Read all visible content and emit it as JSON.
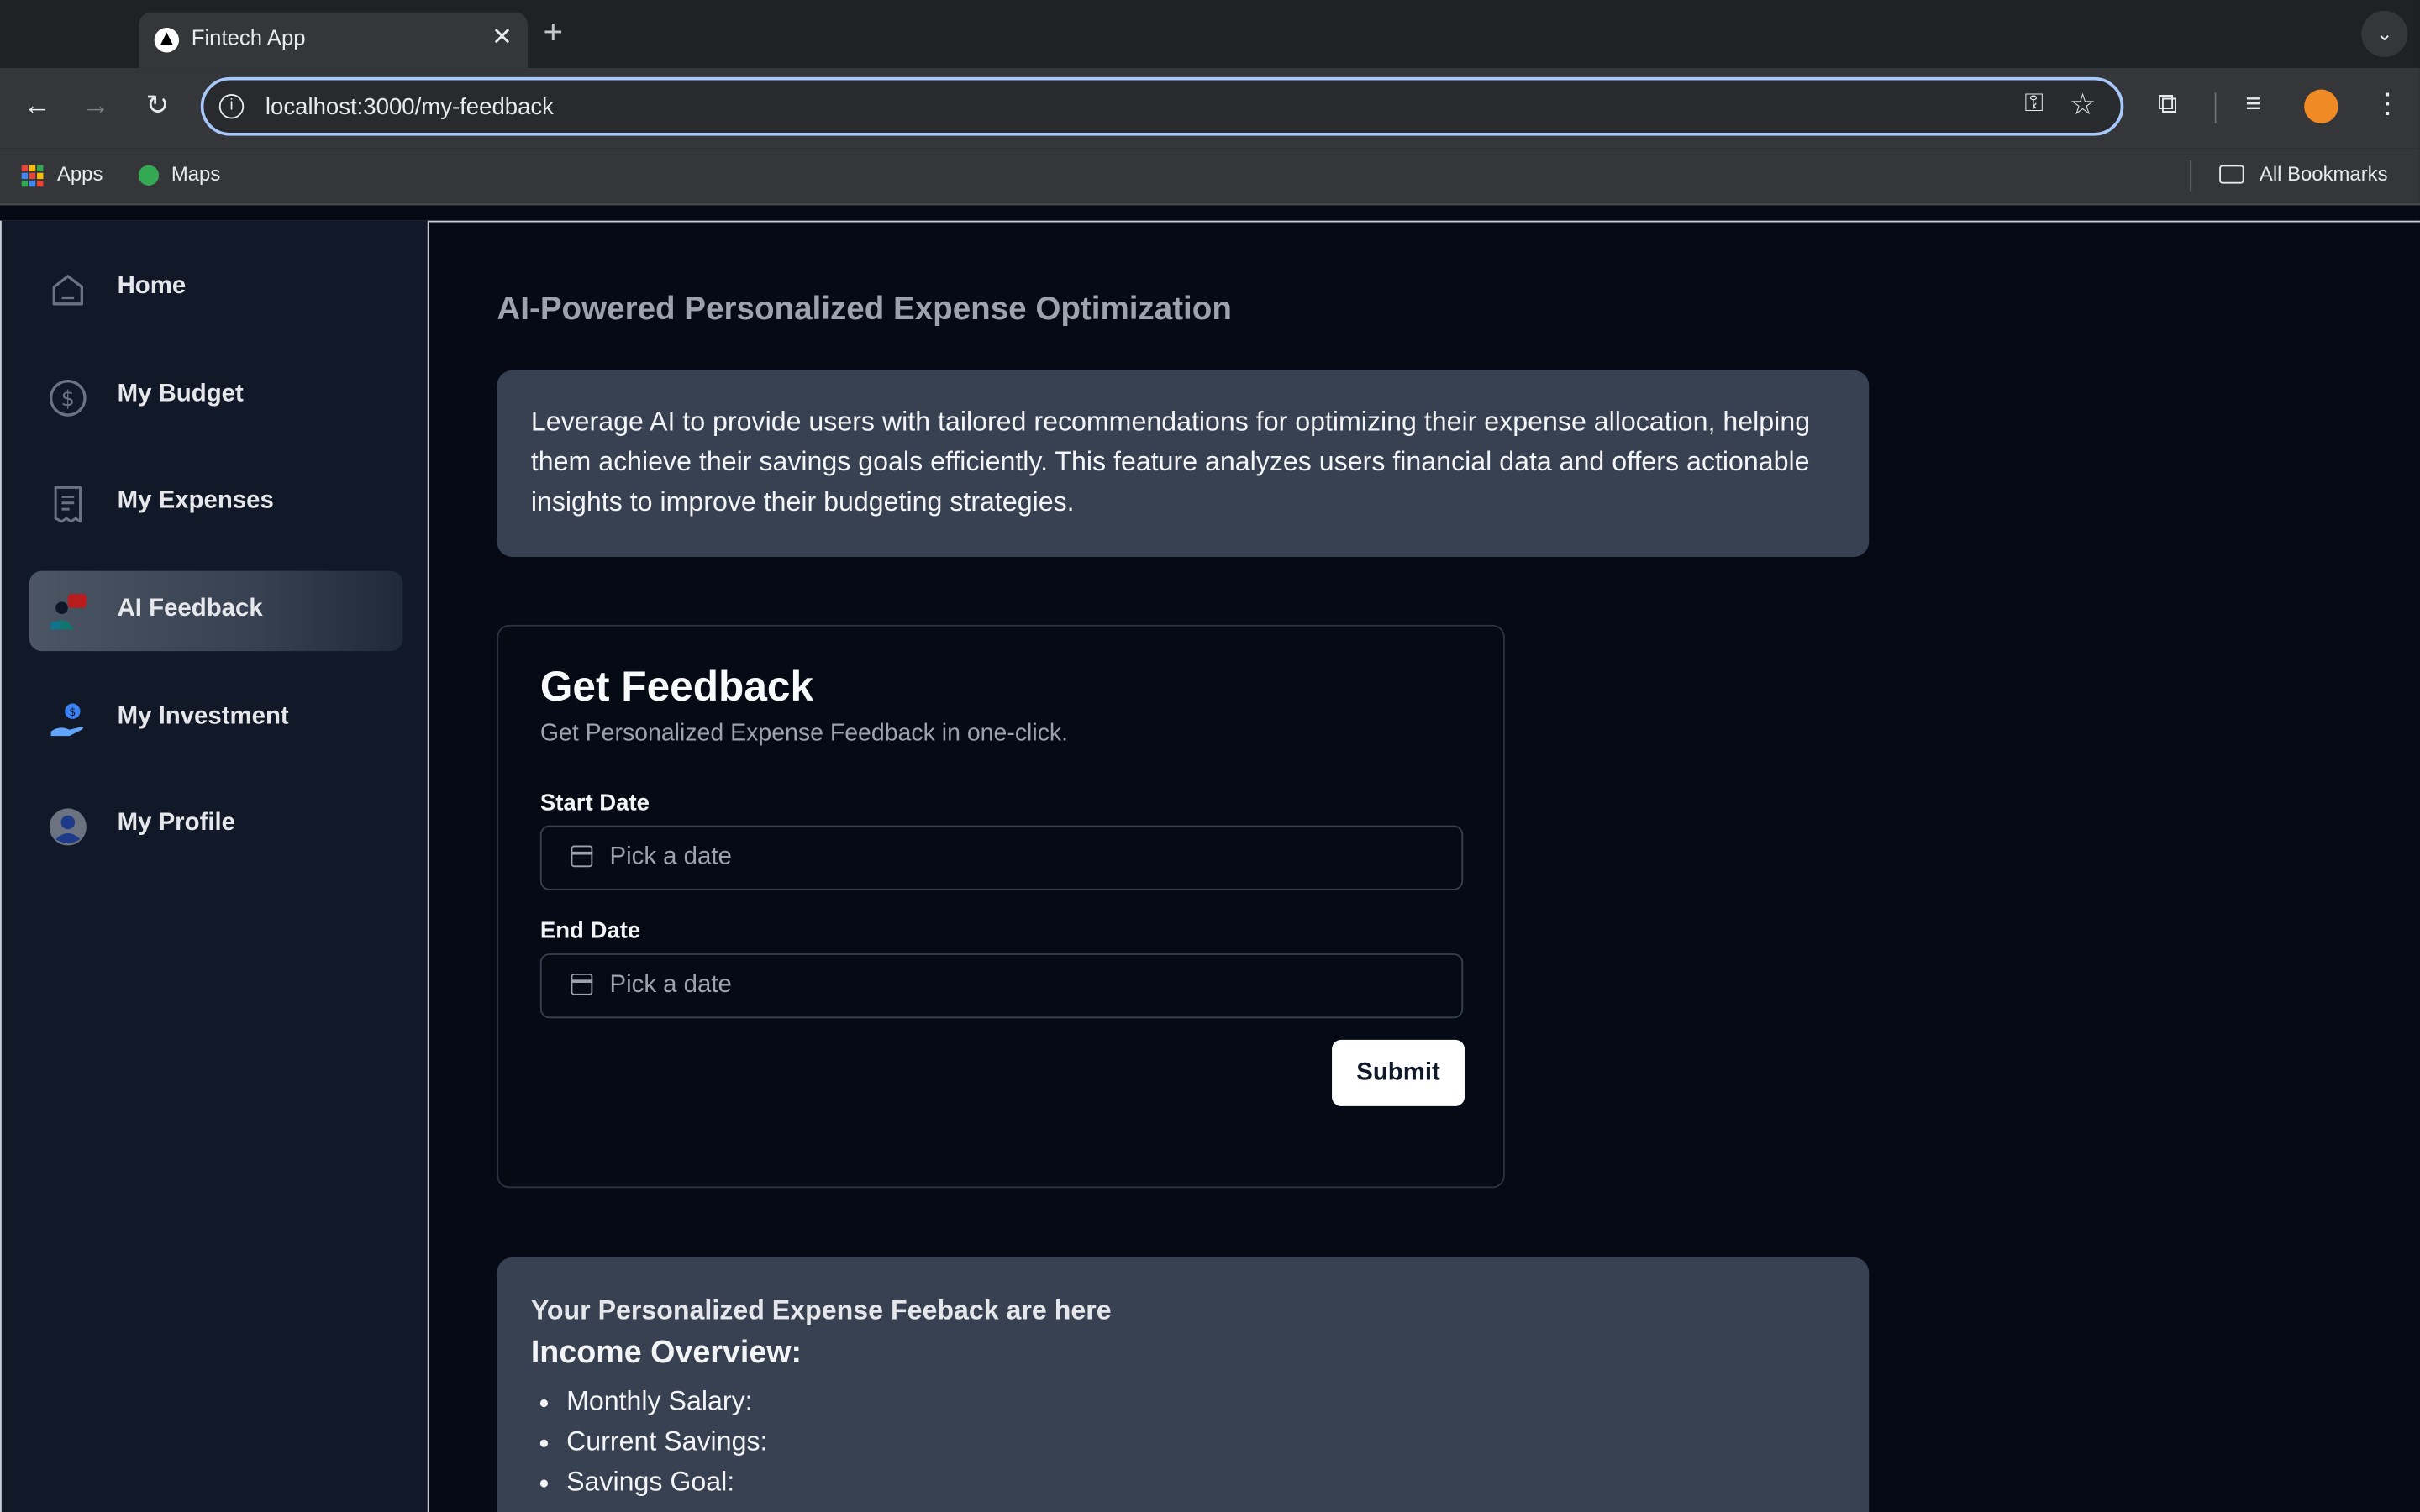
{
  "browser": {
    "tab_title": "Fintech App",
    "url": "localhost:3000/my-feedback",
    "bookmarks": {
      "apps": "Apps",
      "maps": "Maps",
      "all": "All Bookmarks"
    }
  },
  "sidebar": {
    "items": [
      {
        "label": "Home",
        "icon": "home-icon"
      },
      {
        "label": "My Budget",
        "icon": "dollar-icon"
      },
      {
        "label": "My Expenses",
        "icon": "receipt-icon"
      },
      {
        "label": "AI Feedback",
        "icon": "chat-people-icon",
        "active": true
      },
      {
        "label": "My Investment",
        "icon": "invest-icon"
      },
      {
        "label": "My Profile",
        "icon": "user-avatar-icon"
      }
    ]
  },
  "main": {
    "title": "AI-Powered Personalized Expense Optimization",
    "description": "Leverage AI to provide users with tailored recommendations for optimizing their expense allocation, helping them achieve their savings goals efficiently. This feature analyzes users financial data and offers actionable insights to improve their budgeting strategies.",
    "form": {
      "title": "Get Feedback",
      "subtitle": "Get Personalized Expense Feedback in one-click.",
      "start_label": "Start Date",
      "end_label": "End Date",
      "placeholder": "Pick a date",
      "submit": "Submit"
    },
    "result": {
      "heading": "Your Personalized Expense Feeback are here",
      "subheading": "Income Overview:",
      "items": [
        "Monthly Salary:",
        "Current Savings:",
        "Savings Goal:"
      ]
    }
  },
  "colors": {
    "accent": "#a8c7fa",
    "card": "#374151",
    "sidebar": "#111827",
    "page": "#050a14"
  }
}
